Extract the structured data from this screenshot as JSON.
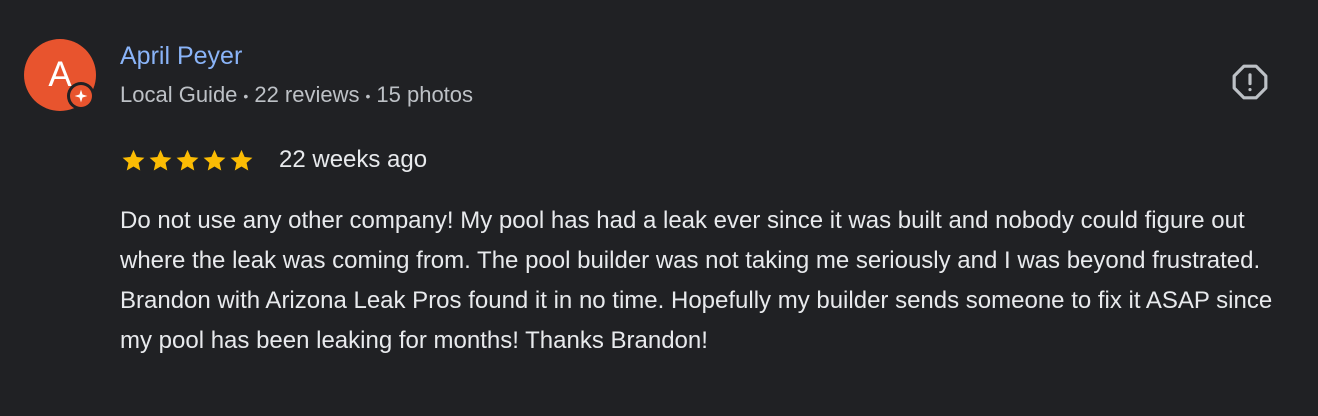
{
  "reviewer": {
    "avatar_letter": "A",
    "avatar_color": "#e8542e",
    "name": "April Peyer",
    "meta": {
      "level": "Local Guide",
      "reviews": "22 reviews",
      "photos": "15 photos"
    },
    "badge_icon": "local-guide-star-icon"
  },
  "review": {
    "rating": 5,
    "rating_max": 5,
    "star_color": "#fbbc04",
    "time_ago": "22 weeks ago",
    "text": "Do not use any other company! My pool has had a leak ever since it was built and nobody could figure out where the leak was coming from. The pool builder was not taking me seriously and I was beyond frustrated. Brandon with Arizona Leak Pros found it in no time. Hopefully my builder sends someone to fix it ASAP since my pool has been leaking for months! Thanks Brandon!"
  },
  "actions": {
    "flag_icon": "report-flag-icon"
  },
  "colors": {
    "background": "#202124",
    "name_link": "#8ab4f8",
    "secondary_text": "#bdc1c6",
    "primary_text": "#e8eaed"
  }
}
